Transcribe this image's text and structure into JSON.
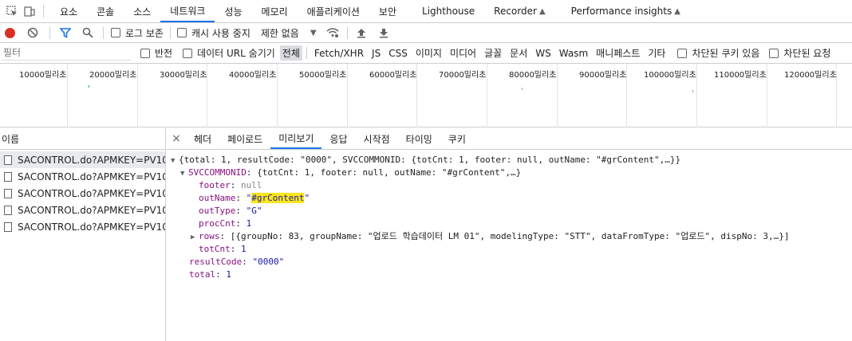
{
  "top_tabs": [
    "요소",
    "콘솔",
    "소스",
    "네트워크",
    "성능",
    "메모리",
    "애플리케이션",
    "보안",
    "Lighthouse",
    "Recorder",
    "Performance insights"
  ],
  "toolbar": {
    "preserve_log": "로그 보존",
    "disable_cache": "캐시 사용 중지",
    "throttling": "제한 없음"
  },
  "filter": {
    "placeholder": "필터",
    "invert": "반전",
    "hide_data_urls": "데이터 URL 숨기기",
    "types": [
      "전체",
      "Fetch/XHR",
      "JS",
      "CSS",
      "이미지",
      "미디어",
      "글꼴",
      "문서",
      "WS",
      "Wasm",
      "매니페스트",
      "기타"
    ],
    "blocked_cookies": "차단된 쿠키 있음",
    "blocked_requests": "차단된 요청"
  },
  "overview": {
    "ticks": [
      "10000밀리초",
      "20000밀리초",
      "30000밀리초",
      "40000밀리초",
      "50000밀리초",
      "60000밀리초",
      "70000밀리초",
      "80000밀리초",
      "90000밀리초",
      "100000밀리초",
      "110000밀리초",
      "120000밀리초"
    ]
  },
  "requests": {
    "header": "이름",
    "rows": [
      "SACONTROL.do?APMKEY=PV10...",
      "SACONTROL.do?APMKEY=PV10...",
      "SACONTROL.do?APMKEY=PV10...",
      "SACONTROL.do?APMKEY=PV10...",
      "SACONTROL.do?APMKEY=PV10..."
    ]
  },
  "details": {
    "close": "×",
    "tabs": [
      "헤더",
      "페이로드",
      "미리보기",
      "응답",
      "시작점",
      "타이밍",
      "쿠키"
    ]
  },
  "preview": {
    "root_summary": "{total: 1, resultCode: \"0000\", SVCCOMMONID: {totCnt: 1, footer: null, outName: \"#grContent\",…}}",
    "svc_key": "SVCCOMMONID",
    "svc_summary": "{totCnt: 1, footer: null, outName: \"#grContent\",…}",
    "footer_key": "footer",
    "footer_val": "null",
    "outname_key": "outName",
    "outname_val": "#grContent",
    "outtype_key": "outType",
    "outtype_val": "\"G\"",
    "proccnt_key": "procCnt",
    "proccnt_val": "1",
    "rows_key": "rows",
    "rows_summary": "[{groupNo: 83, groupName: \"업로드 학습데이터 LM 01\", modelingType: \"STT\", dataFromType: \"업로드\", dispNo: 3,…}]",
    "totcnt_key": "totCnt",
    "totcnt_val": "1",
    "resultcode_key": "resultCode",
    "resultcode_val": "\"0000\"",
    "total_key": "total",
    "total_val": "1"
  }
}
